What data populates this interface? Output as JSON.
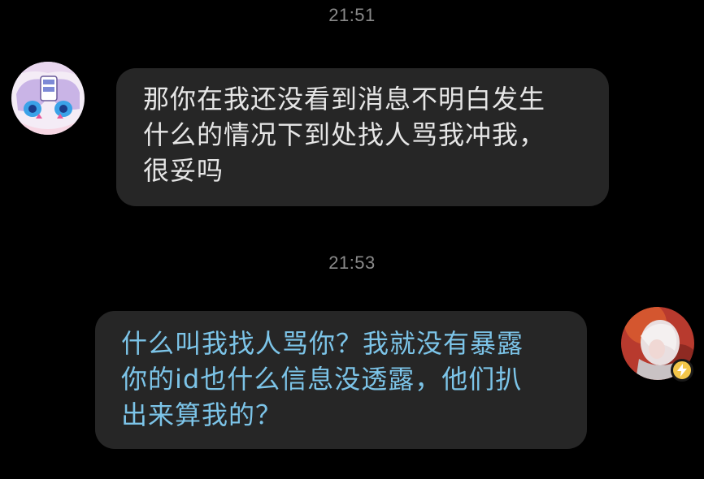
{
  "messages": [
    {
      "timestamp": "21:51",
      "direction": "incoming",
      "text": "那你在我还没看到消息不明白发生\n什么的情况下到处找人骂我冲我，\n很妥吗"
    },
    {
      "timestamp": "21:53",
      "direction": "outgoing",
      "text": "什么叫我找人骂你？我就没有暴露\n你的id也什么信息没透露，他们扒\n出来算我的？"
    }
  ],
  "colors": {
    "background": "#000000",
    "bubble": "#262626",
    "incoming_text": "#e6e6e6",
    "outgoing_text": "#7cc4e8",
    "timestamp": "#8a8a8a",
    "badge": "#f3c64a"
  },
  "icons": {
    "incoming_avatar": "anime-avatar-icon",
    "outgoing_avatar": "user-avatar-icon",
    "badge": "lightning-badge-icon"
  }
}
